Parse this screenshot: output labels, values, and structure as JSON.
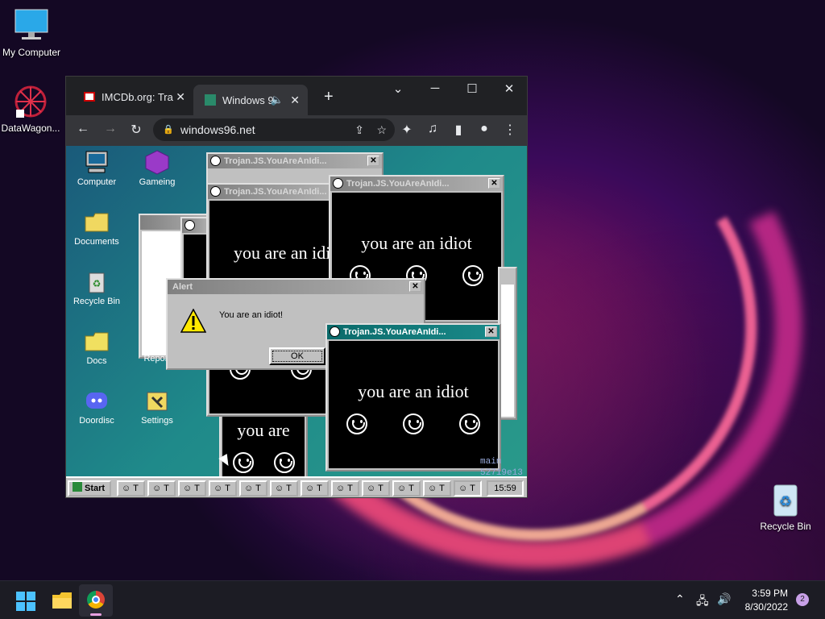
{
  "desktop": {
    "icons": [
      {
        "label": "My Computer"
      },
      {
        "label": "DataWagon..."
      },
      {
        "label": "Recycle Bin"
      }
    ]
  },
  "browser": {
    "tabs": [
      {
        "label": "IMCDb.org: Tra"
      },
      {
        "label": "Windows 9"
      }
    ],
    "new_tab": "+",
    "url": "windows96.net"
  },
  "win96": {
    "icons": [
      {
        "label": "Computer"
      },
      {
        "label": "Gameing"
      },
      {
        "label": "Documents"
      },
      {
        "label": "Recycle Bin"
      },
      {
        "label": "Docs"
      },
      {
        "label": "Doordisc"
      },
      {
        "label": "Settings"
      },
      {
        "label": "Report"
      }
    ],
    "trojan_title": "Trojan.JS.YouAreAnIdi...",
    "trojan_title_short": "Trojan.JS.YouAreAnIdi...",
    "trojan_title_front": "Trojan.JS.YouAreAnIdi...",
    "idiot_text": "you are an idiot",
    "idiot_text_partial": "you are an idio",
    "idiot_text_cut": "you are",
    "alert": {
      "title": "Alert",
      "message": "You are an idiot!",
      "ok": "OK"
    },
    "start": "Start",
    "clock": "15:59",
    "task_item": "T",
    "bg_text1": "main",
    "bg_text2": "52719e13"
  },
  "tray": {
    "time": "3:59 PM",
    "date": "8/30/2022",
    "badge": "2"
  }
}
